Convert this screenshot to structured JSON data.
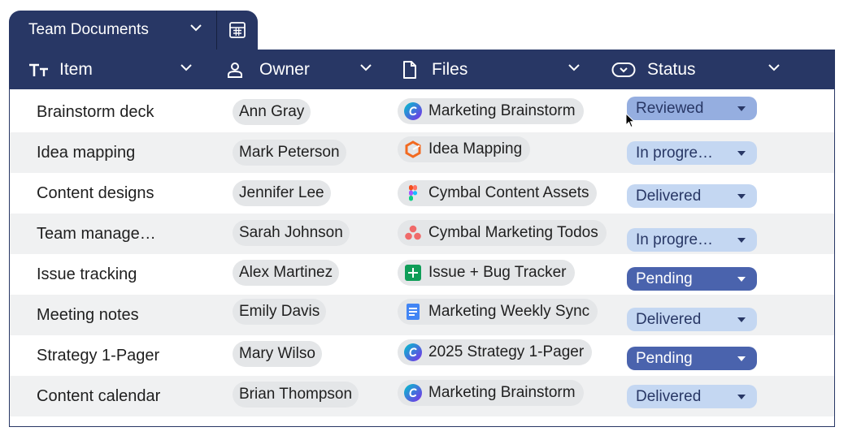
{
  "tab": {
    "title": "Team Documents",
    "icon": "spreadsheet-icon"
  },
  "columns": [
    {
      "label": "Item",
      "icon": "text-type-icon"
    },
    {
      "label": "Owner",
      "icon": "person-icon"
    },
    {
      "label": "Files",
      "icon": "file-icon"
    },
    {
      "label": "Status",
      "icon": "status-chip-icon"
    }
  ],
  "rows": [
    {
      "item": "Brainstorm deck",
      "owner": "Ann Gray",
      "file": "Marketing Brainstorm",
      "file_icon": "canva-icon",
      "status": "Reviewed"
    },
    {
      "item": "Idea mapping",
      "owner": "Mark Peterson",
      "file": "Idea Mapping",
      "file_icon": "miro-icon",
      "status": "In progre…"
    },
    {
      "item": "Content designs",
      "owner": "Jennifer Lee",
      "file": "Cymbal Content Assets",
      "file_icon": "figma-icon",
      "status": "Delivered"
    },
    {
      "item": "Team manage…",
      "owner": "Sarah Johnson",
      "file": "Cymbal Marketing Todos",
      "file_icon": "asana-icon",
      "status": "In progre…"
    },
    {
      "item": "Issue tracking",
      "owner": "Alex Martinez",
      "file": "Issue + Bug Tracker",
      "file_icon": "sheets-icon",
      "status": "Pending"
    },
    {
      "item": "Meeting notes",
      "owner": "Emily Davis",
      "file": "Marketing Weekly Sync",
      "file_icon": "docs-icon",
      "status": "Delivered"
    },
    {
      "item": "Strategy 1-Pager",
      "owner": "Mary Wilso",
      "file": "2025 Strategy 1-Pager",
      "file_icon": "canva-icon",
      "status": "Pending"
    },
    {
      "item": "Content calendar",
      "owner": "Brian Thompson",
      "file": "Marketing Brainstorm",
      "file_icon": "canva-icon",
      "status": "Delivered"
    }
  ],
  "status_colors": {
    "Reviewed": {
      "bg": "#95aee0",
      "fg": "#283765"
    },
    "In progre…": {
      "bg": "#c4d7f2",
      "fg": "#283765"
    },
    "Delivered": {
      "bg": "#c4d7f2",
      "fg": "#283765"
    },
    "Pending": {
      "bg": "#4a63ad",
      "fg": "#ffffff"
    }
  },
  "colors": {
    "header": "#283765",
    "row_alt": "#f0f1f2",
    "chip": "#e4e6e8"
  }
}
